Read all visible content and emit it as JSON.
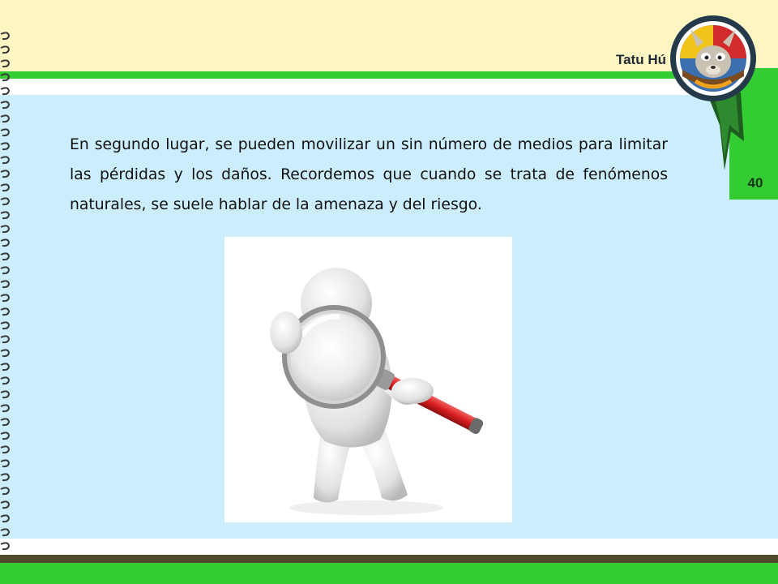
{
  "header": {
    "brand": "Tatu Hú",
    "page_number": "40"
  },
  "main": {
    "paragraph": "En segundo lugar, se pueden movilizar un sin número de medios para limitar las pérdidas y los daños. Recordemos que cuando se trata de fenómenos naturales, se suele hablar de la amenaza y del riesgo."
  },
  "colors": {
    "header_band": "#fdf6c3",
    "accent_green": "#33cc33",
    "content_background": "#cceefc",
    "footer_brown": "#4f4a2c",
    "magnifier_handle": "#d81e1e"
  },
  "icons": {
    "binding": "spiral-binding-icon",
    "mascot": "mascot-badge-icon",
    "illustration": "magnifying-glass-figure-icon"
  }
}
